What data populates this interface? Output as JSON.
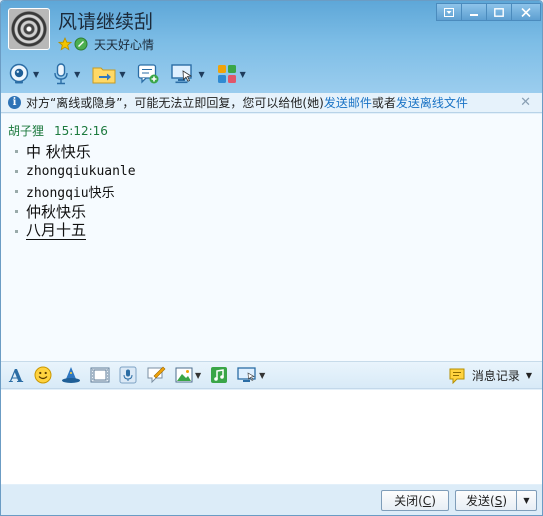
{
  "header": {
    "contact_name": "风请继续刮",
    "signature": "天天好心情"
  },
  "window_buttons": [
    "▣",
    "—",
    "□",
    "✕"
  ],
  "toolbar": {
    "icons": [
      "webcam-icon",
      "microphone-icon",
      "file-transfer-icon",
      "add-chat-icon",
      "remote-desktop-icon",
      "apps-icon"
    ]
  },
  "notice": {
    "text_before": "对方“离线或隐身”，可能无法立即回复，您可以给他(她)",
    "link_email": "发送邮件",
    "or": "或者",
    "link_offline_file": "发送离线文件"
  },
  "chat": {
    "sender": "胡子狸",
    "time": "15:12:16",
    "messages": [
      {
        "text": "中 秋快乐"
      },
      {
        "text": "zhongqiukuanle"
      },
      {
        "text": "zhongqiu快乐"
      },
      {
        "text": "仲秋快乐"
      },
      {
        "text": "八月十五"
      }
    ]
  },
  "input_toolbar": {
    "history_label": "消息记录"
  },
  "buttons": {
    "close_label": "关闭(",
    "close_key": "C",
    "close_end": ")",
    "send_label": "发送(",
    "send_key": "S",
    "send_end": ")"
  },
  "colors": {
    "header_top": "#5ea7d8",
    "link": "#1a73c5",
    "sender": "#1d7a3e"
  }
}
